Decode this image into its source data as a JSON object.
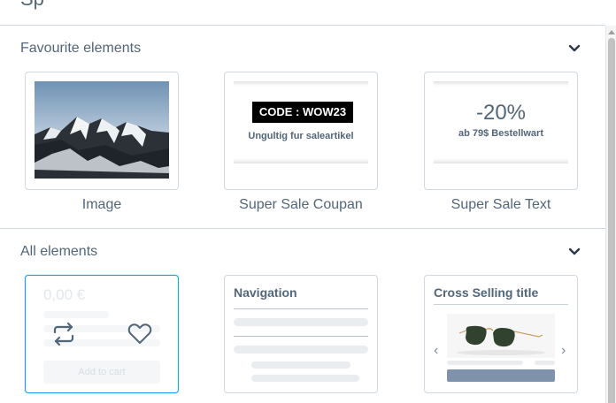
{
  "header": {
    "partial_title": "Sp"
  },
  "favourites": {
    "title": "Favourite elements",
    "items": [
      {
        "label": "Image"
      },
      {
        "label": "Super Sale Coupan",
        "code": "CODE : WOW23",
        "note": "Ungultig fur saleartikel"
      },
      {
        "label": "Super Sale Text",
        "discount": "-20%",
        "note": "ab 79$ Bestellwart"
      }
    ]
  },
  "all_elements": {
    "title": "All elements",
    "buy_box": {
      "price": "0,00 €",
      "add_to_cart": "Add to cart"
    },
    "navigation": {
      "title": "Navigation"
    },
    "cross_selling": {
      "title": "Cross Selling title",
      "prev": "‹",
      "next": "›"
    }
  },
  "colors": {
    "text": "#52667a",
    "border": "#d1d9e0",
    "selected_border": "#189eff",
    "button": "#7f92ab"
  }
}
